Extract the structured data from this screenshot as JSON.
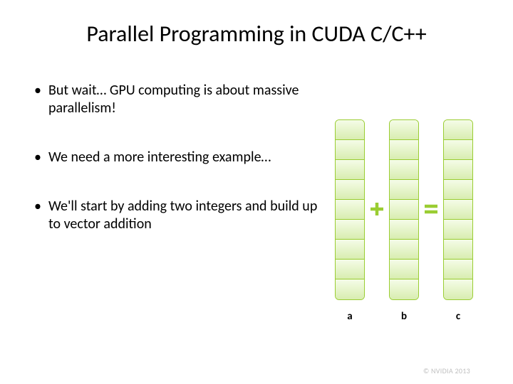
{
  "title": "Parallel Programming in CUDA C/C++",
  "bullets": [
    "But wait… GPU computing is about massive parallelism!",
    "We need a more interesting example…",
    "We'll start by adding two integers and build up to vector addition"
  ],
  "vectors": {
    "cells_per_vector": 9,
    "labels": {
      "a": "a",
      "b": "b",
      "c": "c"
    }
  },
  "operators": {
    "plus": "plus-icon",
    "equals": "equals-icon"
  },
  "colors": {
    "vector_border": "#9acd32",
    "vector_fill_top": "#f5fce8",
    "vector_fill_bottom": "#d8edb0",
    "operator_stroke": "#9acd32"
  },
  "footer": "© NVIDIA 2013"
}
